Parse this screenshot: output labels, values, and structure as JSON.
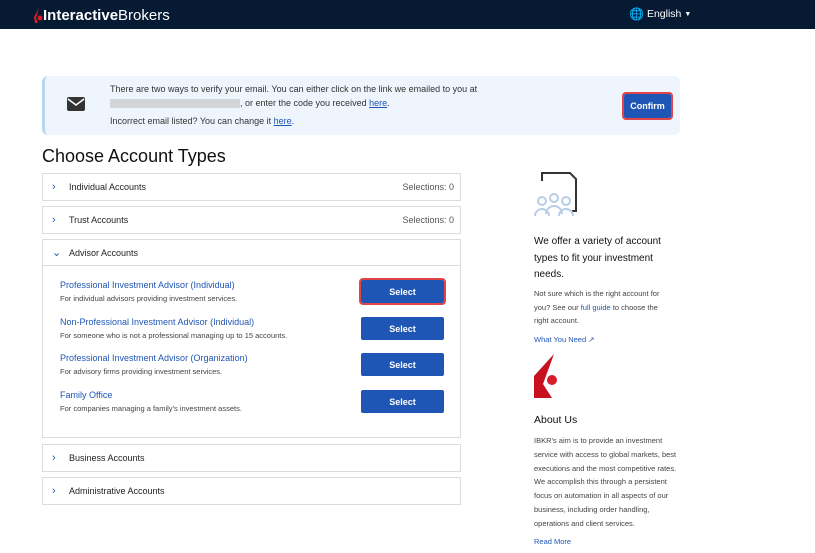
{
  "header": {
    "logo_part1": "Interactive",
    "logo_part2": "Brokers",
    "language": "English"
  },
  "banner": {
    "line1": "There are two ways to verify your email. You can either click on the link we emailed to you at",
    "line2_suffix": ", or enter the code you received ",
    "here1": "here",
    "line3": "Incorrect email listed? You can change it ",
    "here2": "here",
    "confirm": "Confirm"
  },
  "title": "Choose Account Types",
  "accordions": [
    {
      "label": "Individual Accounts",
      "selections": "Selections: 0"
    },
    {
      "label": "Trust Accounts",
      "selections": "Selections: 0"
    },
    {
      "label": "Advisor Accounts"
    },
    {
      "label": "Business Accounts"
    },
    {
      "label": "Administrative Accounts"
    }
  ],
  "advisor_items": [
    {
      "name": "Professional Investment Advisor (Individual)",
      "desc": "For individual advisors providing investment services.",
      "button": "Select"
    },
    {
      "name": "Non-Professional Investment Advisor (Individual)",
      "desc": "For someone who is not a professional managing up to 15 accounts.",
      "button": "Select"
    },
    {
      "name": "Professional Investment Advisor (Organization)",
      "desc": "For advisory firms providing investment services.",
      "button": "Select"
    },
    {
      "name": "Family Office",
      "desc": "For companies managing a family's investment assets.",
      "button": "Select"
    }
  ],
  "side": {
    "heading": "We offer a variety of account types to fit your investment needs.",
    "text1": "Not sure which is the right account for you? See our ",
    "full_guide": "full guide",
    "text2": " to choose the right account.",
    "what_you_need": "What You Need",
    "about_title": "About Us",
    "about_text": "IBKR's aim is to provide an investment service with access to global markets, best executions and the most competitive rates. We accomplish this through a persistent focus on automation in all aspects of our business, including order handling, operations and client services.",
    "read_more": "Read More"
  }
}
